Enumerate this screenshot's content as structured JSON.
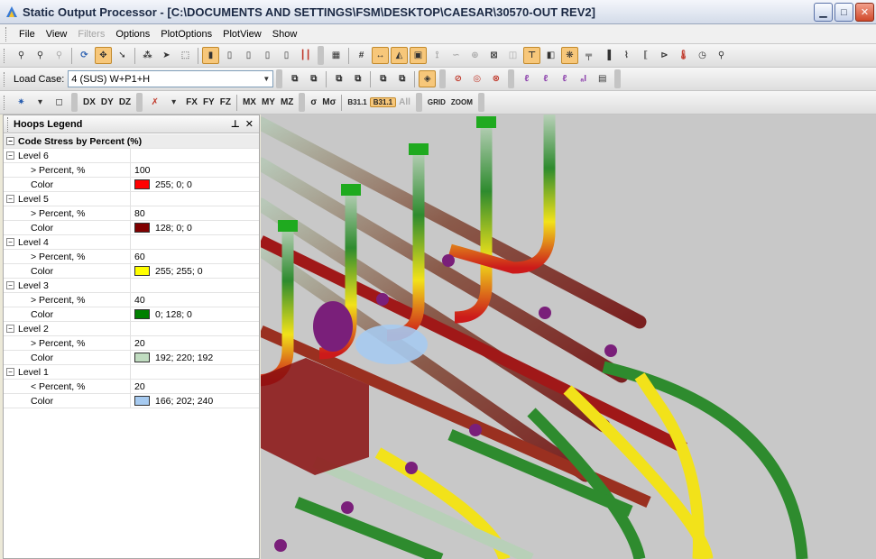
{
  "window": {
    "title": "Static Output Processor - [C:\\DOCUMENTS AND SETTINGS\\FSM\\DESKTOP\\CAESAR\\30570-OUT REV2]",
    "buttons": [
      "minimize",
      "maximize",
      "close"
    ]
  },
  "menu": [
    {
      "label": "File",
      "enabled": true
    },
    {
      "label": "View",
      "enabled": true
    },
    {
      "label": "Filters",
      "enabled": false
    },
    {
      "label": "Options",
      "enabled": true
    },
    {
      "label": "PlotOptions",
      "enabled": true
    },
    {
      "label": "PlotView",
      "enabled": true
    },
    {
      "label": "Show",
      "enabled": true
    }
  ],
  "toolbar2": {
    "load_case_label": "Load Case:",
    "load_case_value": "4 (SUS) W+P1+H"
  },
  "toolbar3": {
    "displacement_buttons": [
      "DX",
      "DY",
      "DZ"
    ],
    "force_buttons": [
      "FX",
      "FY",
      "FZ"
    ],
    "moment_buttons": [
      "MX",
      "MY",
      "MZ"
    ],
    "stress_buttons": [
      "σ",
      "Mσ"
    ],
    "code_buttons": [
      "B31.1",
      "B31.1"
    ],
    "disabled_button": "All",
    "grid_buttons": [
      "GRID",
      "ZOOM"
    ]
  },
  "legend_panel": {
    "title": "Hoops Legend",
    "pin_icon": "pin-icon",
    "close_icon": "close-icon",
    "category": "Code Stress by Percent (%)",
    "levels": [
      {
        "name": "Level 6",
        "percent_label": "> Percent, %",
        "percent": "100",
        "color_label": "Color",
        "color_text": "255; 0; 0",
        "color": "#ff0000"
      },
      {
        "name": "Level 5",
        "percent_label": "> Percent, %",
        "percent": "80",
        "color_label": "Color",
        "color_text": "128; 0; 0",
        "color": "#800000"
      },
      {
        "name": "Level 4",
        "percent_label": "> Percent, %",
        "percent": "60",
        "color_label": "Color",
        "color_text": "255; 255; 0",
        "color": "#ffff00"
      },
      {
        "name": "Level 3",
        "percent_label": "> Percent, %",
        "percent": "40",
        "color_label": "Color",
        "color_text": "0; 128; 0",
        "color": "#008000"
      },
      {
        "name": "Level 2",
        "percent_label": "> Percent, %",
        "percent": "20",
        "color_label": "Color",
        "color_text": "192; 220; 192",
        "color": "#c0dcc0"
      },
      {
        "name": "Level 1",
        "percent_label": "< Percent, %",
        "percent": "20",
        "color_label": "Color",
        "color_text": "166; 202; 240",
        "color": "#a6caf0"
      }
    ]
  },
  "viewport": {
    "background": "#c8c8c8",
    "model": "3d-piping-model",
    "pipe_colors": {
      "green": "#2e8b2e",
      "yellow": "#f2e21a",
      "red": "#cc1a1a",
      "pale": "#b8d0b8",
      "blue": "#a6caf0"
    },
    "restraint_color": "#7a1f7a",
    "hanger_color": "#1faa1f"
  }
}
